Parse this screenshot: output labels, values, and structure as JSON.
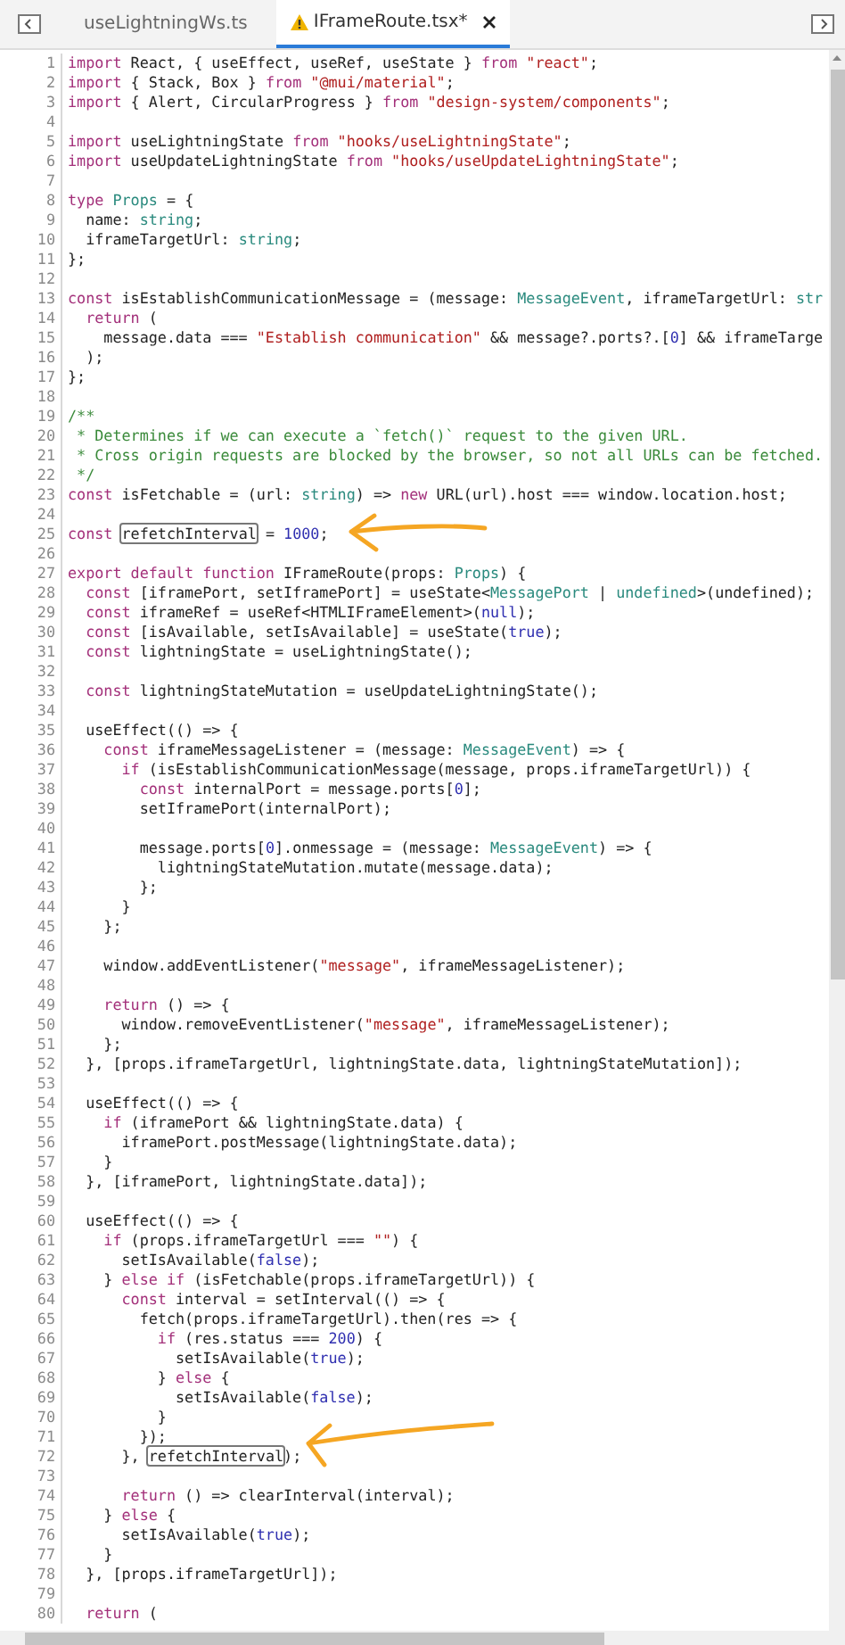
{
  "tabs": [
    {
      "label": "useLightningWs.ts",
      "selected": false,
      "warning": false
    },
    {
      "label": "IFrameRoute.tsx*",
      "selected": true,
      "warning": true
    }
  ],
  "editor": {
    "lines": [
      {
        "n": "1",
        "tokens": [
          {
            "kind": "keyword",
            "text": "import"
          },
          {
            "kind": "plain",
            "text": " React, { useEffect, useRef, useState } "
          },
          {
            "kind": "keyword",
            "text": "from "
          },
          {
            "kind": "string",
            "text": "\"react\""
          },
          {
            "kind": "plain",
            "text": ";"
          }
        ]
      },
      {
        "n": "2",
        "tokens": [
          {
            "kind": "keyword",
            "text": "import"
          },
          {
            "kind": "plain",
            "text": " { Stack, Box } "
          },
          {
            "kind": "keyword",
            "text": "from "
          },
          {
            "kind": "string",
            "text": "\"@mui/material\""
          },
          {
            "kind": "plain",
            "text": ";"
          }
        ]
      },
      {
        "n": "3",
        "tokens": [
          {
            "kind": "keyword",
            "text": "import"
          },
          {
            "kind": "plain",
            "text": " { Alert, CircularProgress } "
          },
          {
            "kind": "keyword",
            "text": "from "
          },
          {
            "kind": "string",
            "text": "\"design-system/components\""
          },
          {
            "kind": "plain",
            "text": ";"
          }
        ]
      },
      {
        "n": "4"
      },
      {
        "n": "5",
        "tokens": [
          {
            "kind": "keyword",
            "text": "import"
          },
          {
            "kind": "plain",
            "text": " useLightningState "
          },
          {
            "kind": "keyword",
            "text": "from "
          },
          {
            "kind": "string",
            "text": "\"hooks/useLightningState\""
          },
          {
            "kind": "plain",
            "text": ";"
          }
        ]
      },
      {
        "n": "6",
        "tokens": [
          {
            "kind": "keyword",
            "text": "import"
          },
          {
            "kind": "plain",
            "text": " useUpdateLightningState "
          },
          {
            "kind": "keyword",
            "text": "from "
          },
          {
            "kind": "string",
            "text": "\"hooks/useUpdateLightningState\""
          },
          {
            "kind": "plain",
            "text": ";"
          }
        ]
      },
      {
        "n": "7"
      },
      {
        "n": "8",
        "tokens": [
          {
            "kind": "keyword",
            "text": "type "
          },
          {
            "kind": "type",
            "text": "Props"
          },
          {
            "kind": "plain",
            "text": " = {"
          }
        ]
      },
      {
        "n": "9",
        "tokens": [
          {
            "kind": "plain",
            "text": "  name: "
          },
          {
            "kind": "type",
            "text": "string"
          },
          {
            "kind": "plain",
            "text": ";"
          }
        ]
      },
      {
        "n": "10",
        "tokens": [
          {
            "kind": "plain",
            "text": "  iframeTargetUrl: "
          },
          {
            "kind": "type",
            "text": "string"
          },
          {
            "kind": "plain",
            "text": ";"
          }
        ]
      },
      {
        "n": "11",
        "tokens": [
          {
            "kind": "plain",
            "text": "};"
          }
        ]
      },
      {
        "n": "12"
      },
      {
        "n": "13",
        "tokens": [
          {
            "kind": "keyword",
            "text": "const"
          },
          {
            "kind": "plain",
            "text": " isEstablishCommunicationMessage = (message: "
          },
          {
            "kind": "type",
            "text": "MessageEvent"
          },
          {
            "kind": "plain",
            "text": ", iframeTargetUrl: "
          },
          {
            "kind": "type",
            "text": "str"
          }
        ]
      },
      {
        "n": "14",
        "tokens": [
          {
            "kind": "keyword",
            "text": "  return"
          },
          {
            "kind": "plain",
            "text": " ("
          }
        ]
      },
      {
        "n": "15",
        "tokens": [
          {
            "kind": "plain",
            "text": "    message.data === "
          },
          {
            "kind": "string",
            "text": "\"Establish communication\""
          },
          {
            "kind": "plain",
            "text": " && message?.ports?.["
          },
          {
            "kind": "number",
            "text": "0"
          },
          {
            "kind": "plain",
            "text": "] && iframeTarge"
          }
        ]
      },
      {
        "n": "16",
        "tokens": [
          {
            "kind": "plain",
            "text": "  );"
          }
        ]
      },
      {
        "n": "17",
        "tokens": [
          {
            "kind": "plain",
            "text": "};"
          }
        ]
      },
      {
        "n": "18"
      },
      {
        "n": "19",
        "tokens": [
          {
            "kind": "comment",
            "text": "/**"
          }
        ]
      },
      {
        "n": "20",
        "tokens": [
          {
            "kind": "comment",
            "text": " * Determines if we can execute a `fetch()` request to the given URL."
          }
        ]
      },
      {
        "n": "21",
        "tokens": [
          {
            "kind": "comment",
            "text": " * Cross origin requests are blocked by the browser, so not all URLs can be fetched."
          }
        ]
      },
      {
        "n": "22",
        "tokens": [
          {
            "kind": "comment",
            "text": " */"
          }
        ]
      },
      {
        "n": "23",
        "tokens": [
          {
            "kind": "keyword",
            "text": "const"
          },
          {
            "kind": "plain",
            "text": " isFetchable = (url: "
          },
          {
            "kind": "type",
            "text": "string"
          },
          {
            "kind": "plain",
            "text": ") => "
          },
          {
            "kind": "keyword",
            "text": "new"
          },
          {
            "kind": "plain",
            "text": " URL(url).host === window.location.host;"
          }
        ]
      },
      {
        "n": "24"
      },
      {
        "n": "25",
        "tokens": [
          {
            "kind": "keyword",
            "text": "const "
          },
          {
            "kind": "boxed",
            "text": "refetchInterval"
          },
          {
            "kind": "plain",
            "text": " = "
          },
          {
            "kind": "number",
            "text": "1000"
          },
          {
            "kind": "plain",
            "text": ";"
          }
        ]
      },
      {
        "n": "26"
      },
      {
        "n": "27",
        "tokens": [
          {
            "kind": "keyword",
            "text": "export default function"
          },
          {
            "kind": "plain",
            "text": " IFrameRoute(props: "
          },
          {
            "kind": "type",
            "text": "Props"
          },
          {
            "kind": "plain",
            "text": ") {"
          }
        ]
      },
      {
        "n": "28",
        "tokens": [
          {
            "kind": "keyword",
            "text": "  const"
          },
          {
            "kind": "plain",
            "text": " [iframePort, setIframePort] = useState<"
          },
          {
            "kind": "type",
            "text": "MessagePort"
          },
          {
            "kind": "plain",
            "text": " | "
          },
          {
            "kind": "type",
            "text": "undefined"
          },
          {
            "kind": "plain",
            "text": ">(undefined);"
          }
        ]
      },
      {
        "n": "29",
        "tokens": [
          {
            "kind": "keyword",
            "text": "  const"
          },
          {
            "kind": "plain",
            "text": " iframeRef = useRef<HTMLIFrameElement>("
          },
          {
            "kind": "number",
            "text": "null"
          },
          {
            "kind": "plain",
            "text": ");"
          }
        ]
      },
      {
        "n": "30",
        "tokens": [
          {
            "kind": "keyword",
            "text": "  const"
          },
          {
            "kind": "plain",
            "text": " [isAvailable, setIsAvailable] = useState("
          },
          {
            "kind": "number",
            "text": "true"
          },
          {
            "kind": "plain",
            "text": ");"
          }
        ]
      },
      {
        "n": "31",
        "tokens": [
          {
            "kind": "keyword",
            "text": "  const"
          },
          {
            "kind": "plain",
            "text": " lightningState = useLightningState();"
          }
        ]
      },
      {
        "n": "32"
      },
      {
        "n": "33",
        "tokens": [
          {
            "kind": "keyword",
            "text": "  const"
          },
          {
            "kind": "plain",
            "text": " lightningStateMutation = useUpdateLightningState();"
          }
        ]
      },
      {
        "n": "34"
      },
      {
        "n": "35",
        "tokens": [
          {
            "kind": "plain",
            "text": "  useEffect(() => {"
          }
        ]
      },
      {
        "n": "36",
        "tokens": [
          {
            "kind": "keyword",
            "text": "    const"
          },
          {
            "kind": "plain",
            "text": " iframeMessageListener = (message: "
          },
          {
            "kind": "type",
            "text": "MessageEvent"
          },
          {
            "kind": "plain",
            "text": ") => {"
          }
        ]
      },
      {
        "n": "37",
        "tokens": [
          {
            "kind": "keyword",
            "text": "      if"
          },
          {
            "kind": "plain",
            "text": " (isEstablishCommunicationMessage(message, props.iframeTargetUrl)) {"
          }
        ]
      },
      {
        "n": "38",
        "tokens": [
          {
            "kind": "keyword",
            "text": "        const"
          },
          {
            "kind": "plain",
            "text": " internalPort = message.ports["
          },
          {
            "kind": "number",
            "text": "0"
          },
          {
            "kind": "plain",
            "text": "];"
          }
        ]
      },
      {
        "n": "39",
        "tokens": [
          {
            "kind": "plain",
            "text": "        setIframePort(internalPort);"
          }
        ]
      },
      {
        "n": "40"
      },
      {
        "n": "41",
        "tokens": [
          {
            "kind": "plain",
            "text": "        message.ports["
          },
          {
            "kind": "number",
            "text": "0"
          },
          {
            "kind": "plain",
            "text": "].onmessage = (message: "
          },
          {
            "kind": "type",
            "text": "MessageEvent"
          },
          {
            "kind": "plain",
            "text": ") => {"
          }
        ]
      },
      {
        "n": "42",
        "tokens": [
          {
            "kind": "plain",
            "text": "          lightningStateMutation.mutate(message.data);"
          }
        ]
      },
      {
        "n": "43",
        "tokens": [
          {
            "kind": "plain",
            "text": "        };"
          }
        ]
      },
      {
        "n": "44",
        "tokens": [
          {
            "kind": "plain",
            "text": "      }"
          }
        ]
      },
      {
        "n": "45",
        "tokens": [
          {
            "kind": "plain",
            "text": "    };"
          }
        ]
      },
      {
        "n": "46"
      },
      {
        "n": "47",
        "tokens": [
          {
            "kind": "plain",
            "text": "    window.addEventListener("
          },
          {
            "kind": "string",
            "text": "\"message\""
          },
          {
            "kind": "plain",
            "text": ", iframeMessageListener);"
          }
        ]
      },
      {
        "n": "48"
      },
      {
        "n": "49",
        "tokens": [
          {
            "kind": "keyword",
            "text": "    return"
          },
          {
            "kind": "plain",
            "text": " () => {"
          }
        ]
      },
      {
        "n": "50",
        "tokens": [
          {
            "kind": "plain",
            "text": "      window.removeEventListener("
          },
          {
            "kind": "string",
            "text": "\"message\""
          },
          {
            "kind": "plain",
            "text": ", iframeMessageListener);"
          }
        ]
      },
      {
        "n": "51",
        "tokens": [
          {
            "kind": "plain",
            "text": "    };"
          }
        ]
      },
      {
        "n": "52",
        "tokens": [
          {
            "kind": "plain",
            "text": "  }, [props.iframeTargetUrl, lightningState.data, lightningStateMutation]);"
          }
        ]
      },
      {
        "n": "53"
      },
      {
        "n": "54",
        "tokens": [
          {
            "kind": "plain",
            "text": "  useEffect(() => {"
          }
        ]
      },
      {
        "n": "55",
        "tokens": [
          {
            "kind": "keyword",
            "text": "    if"
          },
          {
            "kind": "plain",
            "text": " (iframePort && lightningState.data) {"
          }
        ]
      },
      {
        "n": "56",
        "tokens": [
          {
            "kind": "plain",
            "text": "      iframePort.postMessage(lightningState.data);"
          }
        ]
      },
      {
        "n": "57",
        "tokens": [
          {
            "kind": "plain",
            "text": "    }"
          }
        ]
      },
      {
        "n": "58",
        "tokens": [
          {
            "kind": "plain",
            "text": "  }, [iframePort, lightningState.data]);"
          }
        ]
      },
      {
        "n": "59"
      },
      {
        "n": "60",
        "tokens": [
          {
            "kind": "plain",
            "text": "  useEffect(() => {"
          }
        ]
      },
      {
        "n": "61",
        "tokens": [
          {
            "kind": "keyword",
            "text": "    if"
          },
          {
            "kind": "plain",
            "text": " (props.iframeTargetUrl === "
          },
          {
            "kind": "string",
            "text": "\"\""
          },
          {
            "kind": "plain",
            "text": ") {"
          }
        ]
      },
      {
        "n": "62",
        "tokens": [
          {
            "kind": "plain",
            "text": "      setIsAvailable("
          },
          {
            "kind": "number",
            "text": "false"
          },
          {
            "kind": "plain",
            "text": ");"
          }
        ]
      },
      {
        "n": "63",
        "tokens": [
          {
            "kind": "plain",
            "text": "    } "
          },
          {
            "kind": "keyword",
            "text": "else if"
          },
          {
            "kind": "plain",
            "text": " (isFetchable(props.iframeTargetUrl)) {"
          }
        ]
      },
      {
        "n": "64",
        "tokens": [
          {
            "kind": "keyword",
            "text": "      const"
          },
          {
            "kind": "plain",
            "text": " interval = setInterval(() => {"
          }
        ]
      },
      {
        "n": "65",
        "tokens": [
          {
            "kind": "plain",
            "text": "        fetch(props.iframeTargetUrl).then(res => {"
          }
        ]
      },
      {
        "n": "66",
        "tokens": [
          {
            "kind": "keyword",
            "text": "          if"
          },
          {
            "kind": "plain",
            "text": " (res.status === "
          },
          {
            "kind": "number",
            "text": "200"
          },
          {
            "kind": "plain",
            "text": ") {"
          }
        ]
      },
      {
        "n": "67",
        "tokens": [
          {
            "kind": "plain",
            "text": "            setIsAvailable("
          },
          {
            "kind": "number",
            "text": "true"
          },
          {
            "kind": "plain",
            "text": ");"
          }
        ]
      },
      {
        "n": "68",
        "tokens": [
          {
            "kind": "plain",
            "text": "          } "
          },
          {
            "kind": "keyword",
            "text": "else"
          },
          {
            "kind": "plain",
            "text": " {"
          }
        ]
      },
      {
        "n": "69",
        "tokens": [
          {
            "kind": "plain",
            "text": "            setIsAvailable("
          },
          {
            "kind": "number",
            "text": "false"
          },
          {
            "kind": "plain",
            "text": ");"
          }
        ]
      },
      {
        "n": "70",
        "tokens": [
          {
            "kind": "plain",
            "text": "          }"
          }
        ]
      },
      {
        "n": "71",
        "tokens": [
          {
            "kind": "plain",
            "text": "        });"
          }
        ]
      },
      {
        "n": "72",
        "tokens": [
          {
            "kind": "plain",
            "text": "      }, "
          },
          {
            "kind": "boxed",
            "text": "refetchInterval"
          },
          {
            "kind": "plain",
            "text": ");"
          }
        ]
      },
      {
        "n": "73"
      },
      {
        "n": "74",
        "tokens": [
          {
            "kind": "keyword",
            "text": "      return"
          },
          {
            "kind": "plain",
            "text": " () => clearInterval(interval);"
          }
        ]
      },
      {
        "n": "75",
        "tokens": [
          {
            "kind": "plain",
            "text": "    } "
          },
          {
            "kind": "keyword",
            "text": "else"
          },
          {
            "kind": "plain",
            "text": " {"
          }
        ]
      },
      {
        "n": "76",
        "tokens": [
          {
            "kind": "plain",
            "text": "      setIsAvailable("
          },
          {
            "kind": "number",
            "text": "true"
          },
          {
            "kind": "plain",
            "text": ");"
          }
        ]
      },
      {
        "n": "77",
        "tokens": [
          {
            "kind": "plain",
            "text": "    }"
          }
        ]
      },
      {
        "n": "78",
        "tokens": [
          {
            "kind": "plain",
            "text": "  }, [props.iframeTargetUrl]);"
          }
        ]
      },
      {
        "n": "79"
      },
      {
        "n": "80",
        "tokens": [
          {
            "kind": "keyword",
            "text": "  return"
          },
          {
            "kind": "plain",
            "text": " ("
          }
        ]
      }
    ]
  }
}
